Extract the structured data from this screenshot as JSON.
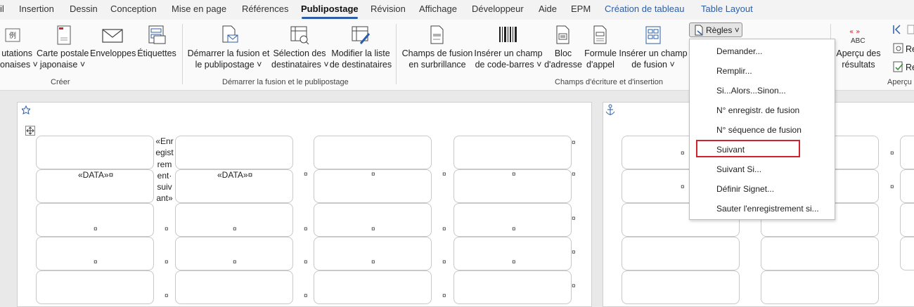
{
  "tabs": [
    {
      "label": "il"
    },
    {
      "label": "Insertion"
    },
    {
      "label": "Dessin"
    },
    {
      "label": "Conception"
    },
    {
      "label": "Mise en page"
    },
    {
      "label": "Références"
    },
    {
      "label": "Publipostage"
    },
    {
      "label": "Révision"
    },
    {
      "label": "Affichage"
    },
    {
      "label": "Développeur"
    },
    {
      "label": "Aide"
    },
    {
      "label": "EPM"
    },
    {
      "label": "Création de tableau"
    },
    {
      "label": "Table Layout"
    }
  ],
  "ribbon": {
    "creer": {
      "label": "Créer",
      "buttons": [
        {
          "line1": "utations",
          "line2": "onaises ˅"
        },
        {
          "line1": "Carte postale",
          "line2": "japonaise ˅"
        },
        {
          "line1": "Enveloppes",
          "line2": ""
        },
        {
          "line1": "Étiquettes",
          "line2": ""
        }
      ]
    },
    "demarrer": {
      "label": "Démarrer la fusion et le publipostage",
      "buttons": [
        {
          "line1": "Démarrer la fusion et",
          "line2": "le publipostage ˅"
        },
        {
          "line1": "Sélection des",
          "line2": "destinataires ˅"
        },
        {
          "line1": "Modifier la liste",
          "line2": "de destinataires"
        }
      ]
    },
    "champs": {
      "label": "Champs d'écriture et d'insertion",
      "buttons": [
        {
          "line1": "Champs de fusion",
          "line2": "en surbrillance"
        },
        {
          "line1": "Insérer un champ",
          "line2": "de code-barres ˅"
        },
        {
          "line1": "Bloc",
          "line2": "d'adresse"
        },
        {
          "line1": "Formule",
          "line2": "d'appel"
        },
        {
          "line1": "Insérer un champ",
          "line2": "de fusion ˅"
        }
      ],
      "regles": "Règles ˅"
    },
    "apercu": {
      "abc": "ABC",
      "line1": "Aperçu des",
      "line2": "résultats",
      "label": "Aperçu",
      "re1": "Re",
      "re2": "Re"
    }
  },
  "menu": {
    "items": [
      {
        "label": "Demander..."
      },
      {
        "label": "Remplir..."
      },
      {
        "label": "Si...Alors...Sinon..."
      },
      {
        "label": "N° enregistr. de fusion"
      },
      {
        "label": "N° séquence de fusion"
      },
      {
        "label": "Suivant"
      },
      {
        "label": "Suivant Si..."
      },
      {
        "label": "Définir Signet..."
      },
      {
        "label": "Sauter l'enregistrement si..."
      }
    ]
  },
  "document": {
    "data_field": "«DATA»¤",
    "next_record_lines": [
      "«Enr",
      "egist",
      "rem",
      "ent·",
      "suiv",
      "ant»"
    ],
    "cell_mark": "¤"
  },
  "colors": {
    "accent": "#2b5ea7",
    "highlight": "#d0232f"
  }
}
